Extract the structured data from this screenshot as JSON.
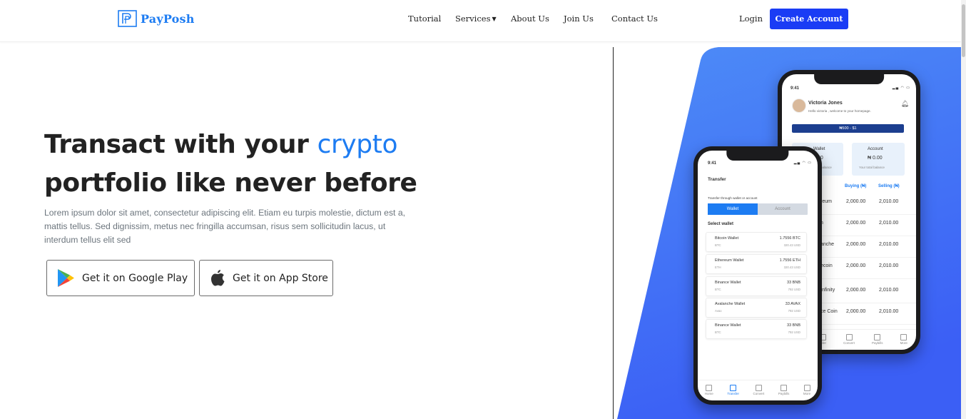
{
  "brand": {
    "name": "PayPosh"
  },
  "nav": {
    "links": [
      "Tutorial",
      "Services",
      "About Us",
      "Join Us",
      "Contact Us"
    ],
    "login": "Login",
    "create_account": "Create Account"
  },
  "hero": {
    "title_part1": "Transact with your ",
    "title_accent": "crypto",
    "title_part2": "portfolio like never before",
    "description": "Lorem ipsum dolor sit amet, consectetur adipiscing elit. Etiam eu turpis molestie, dictum est a, mattis tellus. Sed dignissim, metus nec fringilla accumsan, risus sem sollicitudin lacus, ut interdum tellus elit sed",
    "google_play": "Get it on Google Play",
    "app_store": "Get it on App Store"
  },
  "colors": {
    "accent": "#1d7cf2",
    "button": "#1a3cf5",
    "panel_top": "#4a86f7",
    "panel_bottom": "#3d63f6"
  },
  "icons": {
    "brand": "paypal-like-p-logo",
    "dropdown": "caret-down-icon",
    "google": "google-play-icon",
    "apple": "apple-icon"
  },
  "phone_back": {
    "time": "9:41",
    "user_name": "Victoria Jones",
    "greeting": "Hello victoria , welcome to your homepage.",
    "rate_banner": "₦500 - $1",
    "wallet_label": "Wallet",
    "wallet_value": "00",
    "wallet_sub": "balance",
    "account_label": "Account",
    "account_value": "₦ 0.00",
    "account_sub": "Your total balance",
    "buying_header": "Buying (₦)",
    "selling_header": "Selling (₦)",
    "rates": [
      {
        "coin": "reum",
        "buy": "2,000.00",
        "sell": "2,010.00"
      },
      {
        "coin": "n",
        "buy": "2,000.00",
        "sell": "2,010.00"
      },
      {
        "coin": "anche",
        "buy": "2,000.00",
        "sell": "2,010.00"
      },
      {
        "coin": "ecoin",
        "buy": "2,000.00",
        "sell": "2,010.00"
      },
      {
        "coin": "Infinity",
        "buy": "2,000.00",
        "sell": "2,010.00"
      },
      {
        "coin": "ce Coin",
        "buy": "2,000.00",
        "sell": "2,010.00"
      }
    ],
    "tabs": [
      "nsfer",
      "Convert",
      "Paybills",
      "More"
    ]
  },
  "phone_front": {
    "time": "9:41",
    "title": "Transfer",
    "subtitle": "Transfer through wallet or account",
    "tab_wallet": "Wallet",
    "tab_account": "Account",
    "select_label": "Select wallet",
    "wallets": [
      {
        "name": "Bitcoin Wallet",
        "sym": "BTC",
        "amount": "1.7556 BTC",
        "usd": "320.43 USD"
      },
      {
        "name": "Ethereum Wallet",
        "sym": "ETH",
        "amount": "1.7556 ETH",
        "usd": "320.43 USD"
      },
      {
        "name": "Binance Wallet",
        "sym": "BTC",
        "amount": "33 BNB",
        "usd": "792 USD"
      },
      {
        "name": "Avalanche Wallet",
        "sym": "Avax",
        "amount": "33 AVAX",
        "usd": "792 USD"
      },
      {
        "name": "Binance Wallet",
        "sym": "BTC",
        "amount": "33 BNB",
        "usd": "792 USD"
      }
    ],
    "tabs": [
      "Home",
      "Transfer",
      "Convert",
      "Paybills",
      "More"
    ]
  }
}
